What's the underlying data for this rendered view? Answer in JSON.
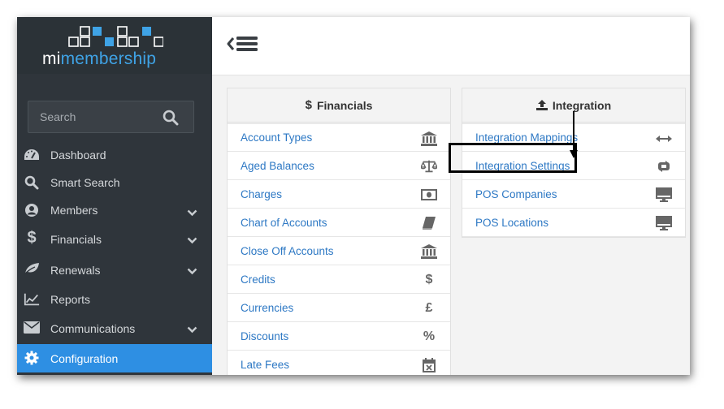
{
  "app": {
    "logo_prefix": "mi",
    "logo_rest": "membership",
    "brand_color": "#3fa3e6",
    "sidebar_bg": "#2f353b",
    "active_color": "#2e8fe3"
  },
  "search": {
    "placeholder": "Search",
    "icon": "search-icon"
  },
  "nav": {
    "items": [
      {
        "label": "Dashboard",
        "icon": "dashboard-icon",
        "expandable": false,
        "active": false
      },
      {
        "label": "Smart Search",
        "icon": "search-icon",
        "expandable": false,
        "active": false
      },
      {
        "label": "Members",
        "icon": "user-circle-icon",
        "expandable": true,
        "active": false
      },
      {
        "label": "Financials",
        "icon": "dollar-icon",
        "expandable": true,
        "active": false
      },
      {
        "label": "Renewals",
        "icon": "leaf-icon",
        "expandable": true,
        "active": false
      },
      {
        "label": "Reports",
        "icon": "line-chart-icon",
        "expandable": false,
        "active": false
      },
      {
        "label": "Communications",
        "icon": "envelope-icon",
        "expandable": true,
        "active": false
      },
      {
        "label": "Configuration",
        "icon": "gear-icon",
        "expandable": false,
        "active": true
      }
    ]
  },
  "financials": {
    "title": "Financials",
    "icon": "dollar-icon",
    "items": [
      {
        "label": "Account Types",
        "icon": "bank-icon"
      },
      {
        "label": "Aged Balances",
        "icon": "balance-scale-icon"
      },
      {
        "label": "Charges",
        "icon": "money-icon"
      },
      {
        "label": "Chart of Accounts",
        "icon": "book-icon"
      },
      {
        "label": "Close Off Accounts",
        "icon": "bank-icon"
      },
      {
        "label": "Credits",
        "icon": "dollar-icon",
        "glyph": "$"
      },
      {
        "label": "Currencies",
        "icon": "pound-icon",
        "glyph": "£"
      },
      {
        "label": "Discounts",
        "icon": "percent-icon",
        "glyph": "%"
      },
      {
        "label": "Late Fees",
        "icon": "calendar-times-icon"
      }
    ]
  },
  "integration": {
    "title": "Integration",
    "icon": "upload-icon",
    "items": [
      {
        "label": "Integration Mappings",
        "icon": "arrows-h-icon"
      },
      {
        "label": "Integration Settings",
        "icon": "exchange-icon",
        "highlighted": true
      },
      {
        "label": "POS Companies",
        "icon": "desktop-icon"
      },
      {
        "label": "POS Locations",
        "icon": "desktop-icon"
      }
    ]
  }
}
